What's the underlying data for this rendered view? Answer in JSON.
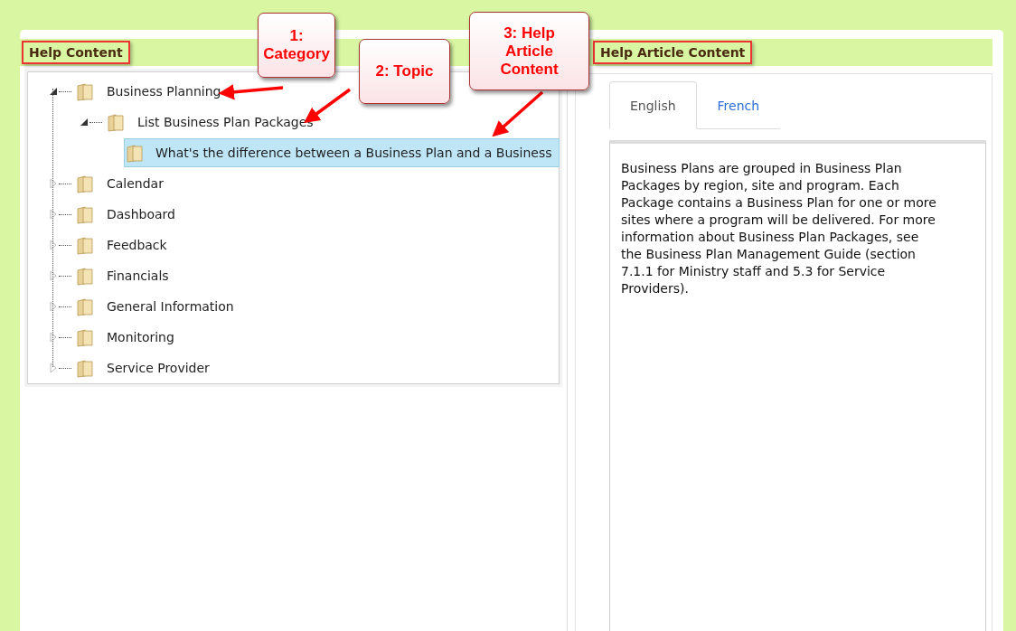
{
  "left_panel": {
    "title": "Help Content",
    "tree": [
      {
        "label": "Business Planning",
        "expanded": true,
        "selected": false,
        "children": [
          {
            "label": "List Business Plan Packages",
            "expanded": true,
            "selected": false,
            "children": [
              {
                "label": "What's the difference between a Business Plan and a Business",
                "selected": true
              }
            ]
          }
        ]
      },
      {
        "label": "Calendar",
        "expanded": false,
        "selected": false
      },
      {
        "label": "Dashboard",
        "expanded": false,
        "selected": false
      },
      {
        "label": "Feedback",
        "expanded": false,
        "selected": false
      },
      {
        "label": "Financials",
        "expanded": false,
        "selected": false
      },
      {
        "label": "General Information",
        "expanded": false,
        "selected": false
      },
      {
        "label": "Monitoring",
        "expanded": false,
        "selected": false
      },
      {
        "label": "Service Provider",
        "expanded": false,
        "selected": false
      }
    ]
  },
  "right_panel": {
    "title": "Help Article Content",
    "tabs": [
      {
        "label": "English",
        "selected": true
      },
      {
        "label": "French",
        "selected": false
      }
    ],
    "article": "Business Plans are grouped in Business Plan Packages by region, site and program. Each Package contains a Business Plan for one or more sites where a program will be delivered. For more information about Business Plan Packages, see the Business Plan Management Guide (section 7.1.1 for Ministry staff and 5.3 for Service Providers)."
  },
  "callouts": [
    {
      "text": "1: Category"
    },
    {
      "text": "2: Topic"
    },
    {
      "text": "3: Help Article Content"
    }
  ]
}
